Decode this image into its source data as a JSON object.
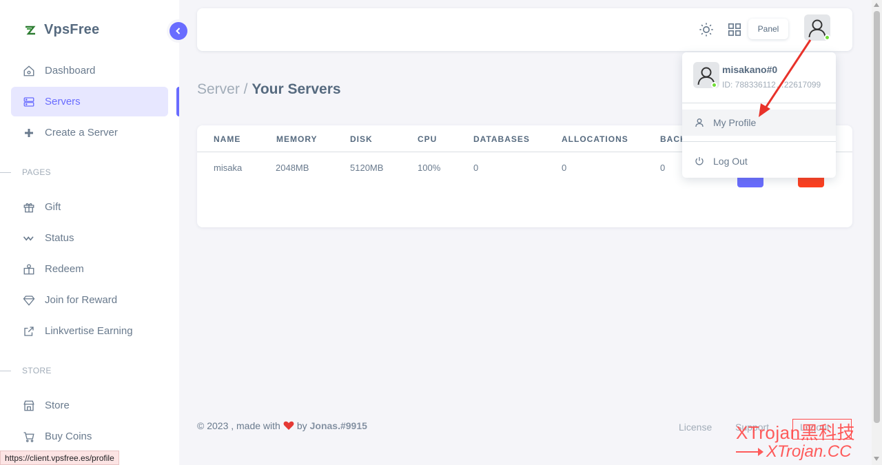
{
  "brand": {
    "name": "VpsFree",
    "accent": "#696cff"
  },
  "sidebar": {
    "main_items": [
      {
        "label": "Dashboard",
        "icon": "home-icon"
      },
      {
        "label": "Servers",
        "icon": "server-icon",
        "active": true
      },
      {
        "label": "Create a Server",
        "icon": "plus-icon"
      }
    ],
    "sections": [
      {
        "header": "PAGES",
        "items": [
          {
            "label": "Gift",
            "icon": "gift-icon"
          },
          {
            "label": "Status",
            "icon": "pulse-icon"
          },
          {
            "label": "Redeem",
            "icon": "redeem-icon"
          },
          {
            "label": "Join for Reward",
            "icon": "diamond-icon"
          },
          {
            "label": "Linkvertise Earning",
            "icon": "external-link-icon"
          }
        ]
      },
      {
        "header": "STORE",
        "items": [
          {
            "label": "Store",
            "icon": "store-icon"
          },
          {
            "label": "Buy Coins",
            "icon": "cart-icon"
          }
        ]
      }
    ]
  },
  "navbar": {
    "panel_label": "Panel",
    "icons": [
      "sun-icon",
      "grid-icon"
    ]
  },
  "page": {
    "breadcrumb_parent": "Server /",
    "title": "Your Servers"
  },
  "table": {
    "columns": [
      "NAME",
      "MEMORY",
      "DISK",
      "CPU",
      "DATABASES",
      "ALLOCATIONS",
      "BACK"
    ],
    "rows": [
      {
        "name": "misaka",
        "memory": "2048MB",
        "disk": "5120MB",
        "cpu": "100%",
        "databases": "0",
        "allocations": "0",
        "backups": "0"
      }
    ]
  },
  "user_menu": {
    "username": "misakano#0",
    "user_id": "ID: 788336112…22617099",
    "items": [
      {
        "label": "My Profile",
        "icon": "user-icon"
      },
      {
        "label": "Log Out",
        "icon": "power-icon"
      }
    ]
  },
  "footer": {
    "prefix": "© 2023 , made with",
    "by": "by",
    "author": "Jonas.#9915",
    "links": [
      "License",
      "Support",
      "Logout"
    ]
  },
  "status_bar": {
    "url": "https://client.vpsfree.es/profile"
  },
  "watermark": {
    "line1": "XTrojan黑科技",
    "line2": "XTrojan.CC"
  }
}
